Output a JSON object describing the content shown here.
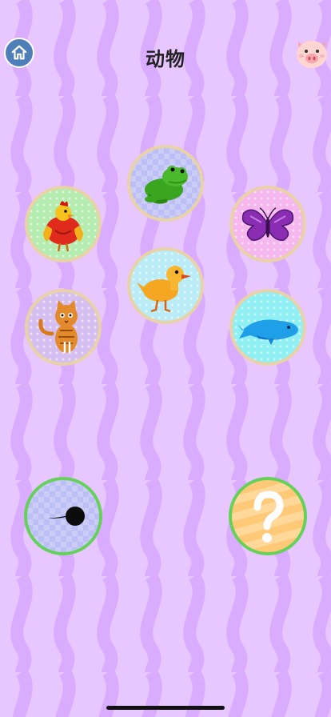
{
  "header": {
    "title": "动物"
  },
  "animals": [
    {
      "name": "frog-icon"
    },
    {
      "name": "rooster-icon"
    },
    {
      "name": "butterfly-icon"
    },
    {
      "name": "duck-icon"
    },
    {
      "name": "cat-icon"
    },
    {
      "name": "whale-icon"
    }
  ],
  "bottom": {
    "silhouette": "tadpole-icon",
    "mystery": "?"
  },
  "colors": {
    "background": "#e8c6ff",
    "home_button": "#4f7fb8",
    "ring": "#66d15a"
  }
}
